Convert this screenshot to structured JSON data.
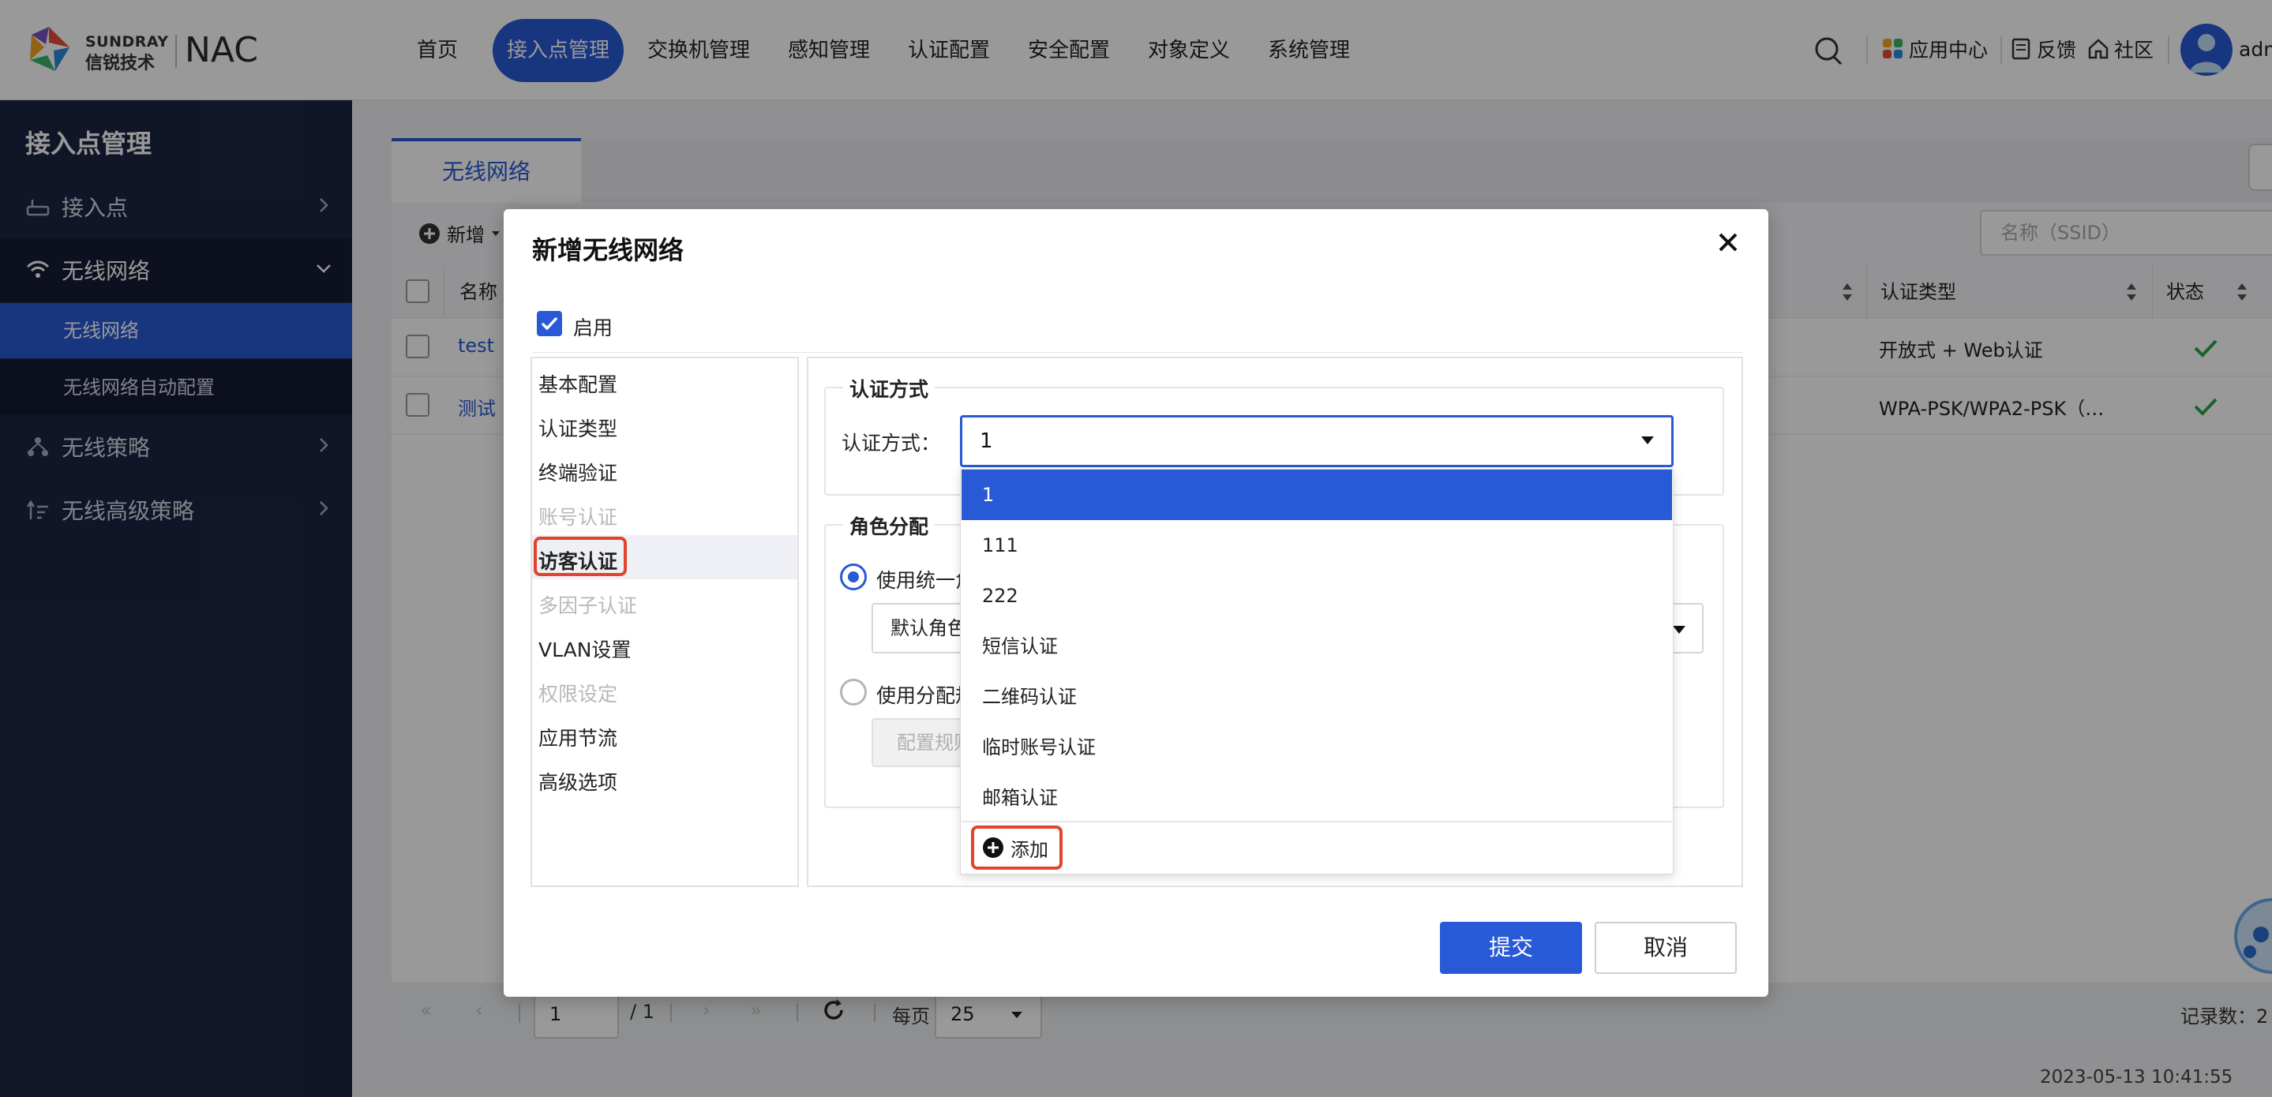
{
  "header": {
    "brand_en": "SUNDRAY",
    "brand_cn": "信锐技术",
    "product": "NAC",
    "nav": [
      "首页",
      "接入点管理",
      "交换机管理",
      "感知管理",
      "认证配置",
      "安全配置",
      "对象定义",
      "系统管理"
    ],
    "active_nav": "接入点管理",
    "links": {
      "app_center": "应用中心",
      "feedback": "反馈",
      "community": "社区"
    },
    "user": "adm",
    "accent": "#2859d6"
  },
  "sidebar": {
    "title": "接入点管理",
    "items": [
      {
        "label": "接入点",
        "icon": "router-icon"
      },
      {
        "label": "无线网络",
        "icon": "wifi-icon",
        "open": true
      },
      {
        "label": "无线策略",
        "icon": "policy-icon"
      },
      {
        "label": "无线高级策略",
        "icon": "advanced-policy-icon"
      }
    ],
    "subitems": [
      "无线网络",
      "无线网络自动配置"
    ]
  },
  "page": {
    "tab": "无线网络",
    "toolbar": {
      "new_label": "新增"
    },
    "search_placeholder": "名称（SSID）",
    "columns": {
      "name": "名称",
      "auth_type": "认证类型",
      "status": "状态"
    },
    "rows": [
      {
        "name": "test",
        "auth": "开放式 + Web认证"
      },
      {
        "name": "测试",
        "auth": "WPA-PSK/WPA2-PSK（…"
      }
    ],
    "pager": {
      "page": "1",
      "total_pages": "/ 1",
      "per_page_label": "每页",
      "per_page": "25",
      "records_label": "记录数：2"
    },
    "footer_time": "2023-05-13 10:41:55"
  },
  "dialog": {
    "title": "新增无线网络",
    "enable_label": "启用",
    "menu": [
      {
        "label": "基本配置",
        "dim": false
      },
      {
        "label": "认证类型",
        "dim": false
      },
      {
        "label": "终端验证",
        "dim": false
      },
      {
        "label": "账号认证",
        "dim": true
      },
      {
        "label": "访客认证",
        "dim": false,
        "selected": true
      },
      {
        "label": "多因子认证",
        "dim": true
      },
      {
        "label": "VLAN设置",
        "dim": false
      },
      {
        "label": "权限设定",
        "dim": true
      },
      {
        "label": "应用节流",
        "dim": false
      },
      {
        "label": "高级选项",
        "dim": false
      }
    ],
    "auth_section": {
      "legend": "认证方式",
      "label": "认证方式：",
      "value": "1"
    },
    "role_section": {
      "legend": "角色分配",
      "opt_unified": "使用统一角",
      "default_role": "默认角色",
      "opt_rules": "使用分配规",
      "config_rules": "配置规则"
    },
    "dropdown_options": [
      "1",
      "111",
      "222",
      "短信认证",
      "二维码认证",
      "临时账号认证",
      "邮箱认证"
    ],
    "dropdown_selected": "1",
    "dropdown_add": "添加",
    "submit": "提交",
    "cancel": "取消",
    "highlight_color": "#e1432e"
  }
}
